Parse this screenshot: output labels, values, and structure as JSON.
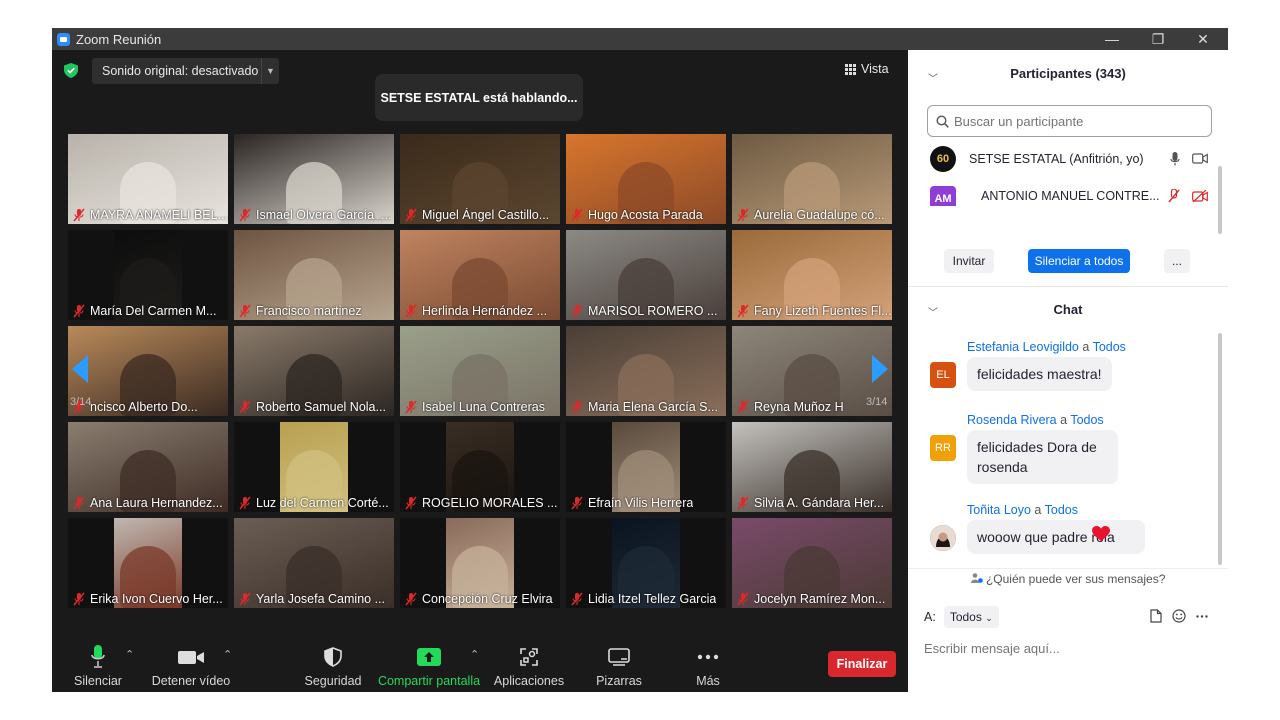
{
  "window": {
    "title": "Zoom Reunión",
    "minimize": "—",
    "restore": "❐",
    "close": "✕"
  },
  "topbar": {
    "sound": "Sonido original: desactivado",
    "speaking": "SETSE ESTATAL está hablando...",
    "view": "Vista"
  },
  "gallery": {
    "page": "3/14",
    "tiles": [
      {
        "name": "MAYRA ANAMELI BEL...",
        "bg": "#b8b2aa",
        "fg": "#e8e4de"
      },
      {
        "name": "Ismael Olvera García_...",
        "bg": "#2a2522",
        "fg": "#d9d4cc"
      },
      {
        "name": "Miguel Ángel Castillo...",
        "bg": "#3a2a1a",
        "fg": "#5c4630"
      },
      {
        "name": "Hugo Acosta Parada",
        "bg": "#d8762c",
        "fg": "#8c4a28"
      },
      {
        "name": "Aurelia Guadalupe có...",
        "bg": "#6e5a42",
        "fg": "#b89a78"
      },
      {
        "name": "María Del Carmen M...",
        "bg": "#0d0d0d",
        "fg": "#1e1c1a"
      },
      {
        "name": "Francisco martinez",
        "bg": "#6e5440",
        "fg": "#b7a48e"
      },
      {
        "name": "Herlinda Hernández ...",
        "bg": "#c08460",
        "fg": "#7a4a32"
      },
      {
        "name": "MARISOL ROMERO ...",
        "bg": "#8c8a86",
        "fg": "#4a3f3a"
      },
      {
        "name": "Fany Lizeth Fuentes Fl...",
        "bg": "#9a6a3a",
        "fg": "#d4a27a"
      },
      {
        "name": "ncisco Alberto Do...",
        "bg": "#b98a5a",
        "fg": "#3a2a22"
      },
      {
        "name": "Roberto Samuel Nola...",
        "bg": "#8a7a6a",
        "fg": "#2c2622"
      },
      {
        "name": "Isabel Luna Contreras",
        "bg": "#9aa08a",
        "fg": "#7a7266"
      },
      {
        "name": "Maria Elena García S...",
        "bg": "#4a3f36",
        "fg": "#8a6e5a"
      },
      {
        "name": "Reyna Muñoz H",
        "bg": "#8e867a",
        "fg": "#5a4e44"
      },
      {
        "name": "Ana Laura Hernandez...",
        "bg": "#8a7e70",
        "fg": "#3e2c24"
      },
      {
        "name": "Luz del Carmen Corté...",
        "bg": "#b8a050",
        "fg": "#d2c080"
      },
      {
        "name": "ROGELIO MORALES ...",
        "bg": "#3a2e24",
        "fg": "#1a1410"
      },
      {
        "name": "Efraín Vilis Herrera",
        "bg": "#5a4a3c",
        "fg": "#a08e7a"
      },
      {
        "name": "Silvia A. Gándara Her...",
        "bg": "#c4c2be",
        "fg": "#3a302a"
      },
      {
        "name": "Erika Ivon Cuervo Her...",
        "bg": "#c0b8b0",
        "fg": "#7a3a2a"
      },
      {
        "name": "Yarla Josefa Camino ...",
        "bg": "#6a5e54",
        "fg": "#3a2e28"
      },
      {
        "name": "Concepción Cruz Elvira",
        "bg": "#8a6a5a",
        "fg": "#c7b19a"
      },
      {
        "name": "Lidia Itzel Tellez Garcia",
        "bg": "#0a1420",
        "fg": "#1e2a36"
      },
      {
        "name": "Jocelyn Ramírez Mon...",
        "bg": "#7a4a6a",
        "fg": "#4a3a34"
      }
    ]
  },
  "toolbar": {
    "mute": "Silenciar",
    "video": "Detener vídeo",
    "security": "Seguridad",
    "share": "Compartir pantalla",
    "apps": "Aplicaciones",
    "whiteboards": "Pizarras",
    "more": "Más",
    "end": "Finalizar"
  },
  "participants": {
    "title": "Participantes (343)",
    "search_placeholder": "Buscar un participante",
    "rows": [
      {
        "name": "SETSE ESTATAL (Anfitrión, yo)",
        "avatar": "60"
      },
      {
        "name": "ANTONIO MANUEL CONTRE...",
        "avatar": "AM"
      }
    ],
    "invite": "Invitar",
    "mute_all": "Silenciar a todos",
    "more": "..."
  },
  "chat": {
    "title": "Chat",
    "to_word": "a",
    "messages": [
      {
        "from": "Estefania Leovigildo",
        "to": "Todos",
        "avatar": "EL",
        "text": "felicidades maestra!"
      },
      {
        "from": "Rosenda Rivera",
        "to": "Todos",
        "avatar": "RR",
        "text": "felicidades Dora de rosenda"
      },
      {
        "from": "Toñita Loyo",
        "to": "Todos",
        "avatar": "",
        "text": "wooow que padre rola"
      }
    ],
    "who_can_see": "¿Quién puede ver sus mensajes?",
    "to_label": "A:",
    "to_value": "Todos",
    "compose_placeholder": "Escribir mensaje aquí..."
  },
  "colors": {
    "accent": "#0e71eb",
    "end": "#d9272e",
    "share": "#23d959",
    "muted": "#e02828"
  }
}
